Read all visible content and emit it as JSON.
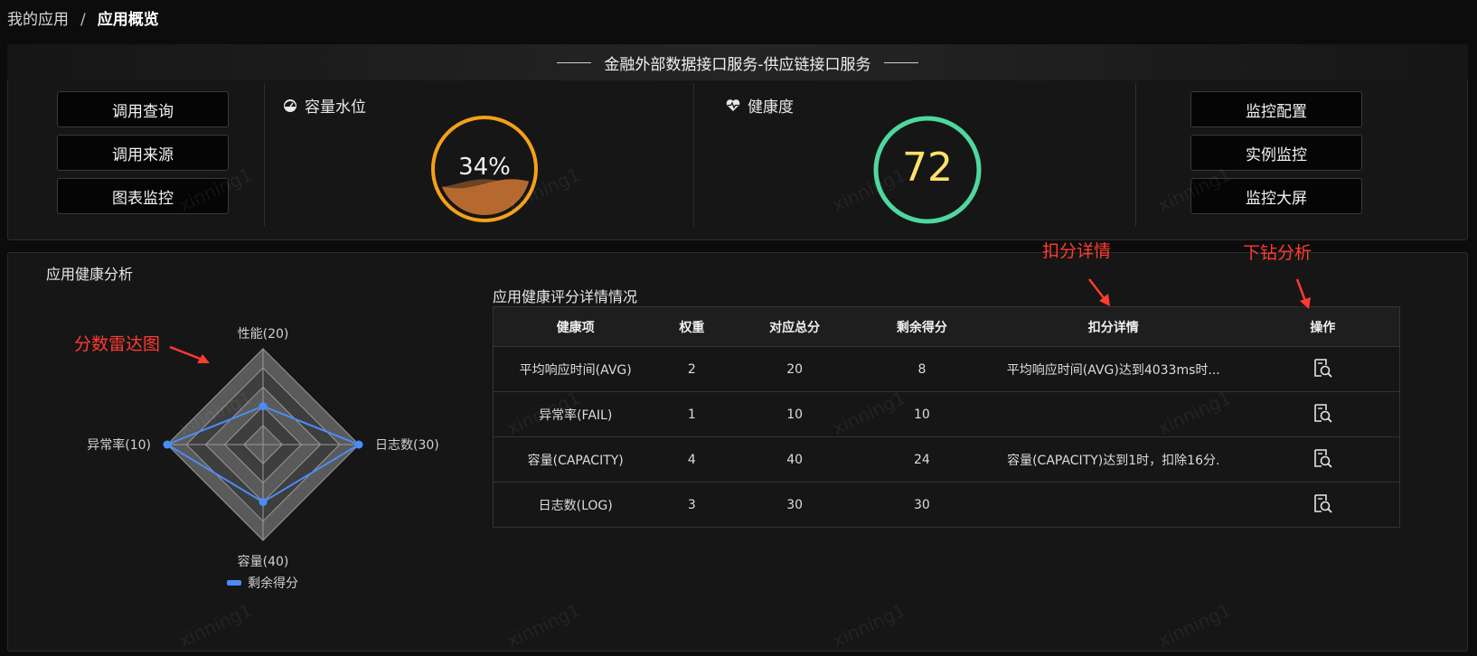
{
  "breadcrumb": {
    "parent": "我的应用",
    "separator": "/",
    "current": "应用概览"
  },
  "service": {
    "title": "金融外部数据接口服务-供应链接口服务"
  },
  "left_buttons": [
    "调用查询",
    "调用来源",
    "图表监控"
  ],
  "right_buttons": [
    "监控配置",
    "实例监控",
    "监控大屏"
  ],
  "capacity": {
    "label": "容量水位",
    "value_text": "34%",
    "value": 0.34,
    "ring_color": "#f5a01a",
    "fill_color": "#b5692f"
  },
  "health": {
    "label": "健康度",
    "score": "72",
    "ring_color": "#4ed8a0",
    "score_color": "#ffe16b"
  },
  "analysis": {
    "title": "应用健康分析"
  },
  "radar": {
    "axes": [
      "性能(20)",
      "日志数(30)",
      "容量(40)",
      "异常率(10)"
    ],
    "legend": "剩余得分",
    "series_color": "#4a8cf7"
  },
  "chart_data": {
    "type": "radar",
    "categories": [
      "性能(20)",
      "日志数(30)",
      "容量(40)",
      "异常率(10)"
    ],
    "max": [
      20,
      30,
      40,
      10
    ],
    "series": [
      {
        "name": "剩余得分",
        "values": [
          8,
          30,
          24,
          10
        ]
      }
    ]
  },
  "table": {
    "title": "应用健康评分详情情况",
    "headers": [
      "健康项",
      "权重",
      "对应总分",
      "剩余得分",
      "扣分详情",
      "操作"
    ],
    "rows": [
      {
        "item": "平均响应时间(AVG)",
        "weight": "2",
        "total": "20",
        "remain": "8",
        "detail": "平均响应时间(AVG)达到4033ms时..."
      },
      {
        "item": "异常率(FAIL)",
        "weight": "1",
        "total": "10",
        "remain": "10",
        "detail": ""
      },
      {
        "item": "容量(CAPACITY)",
        "weight": "4",
        "total": "40",
        "remain": "24",
        "detail": "容量(CAPACITY)达到1时，扣除16分."
      },
      {
        "item": "日志数(LOG)",
        "weight": "3",
        "total": "30",
        "remain": "30",
        "detail": ""
      }
    ]
  },
  "annotations": {
    "radar": "分数雷达图",
    "deduction": "扣分详情",
    "drill": "下钻分析"
  },
  "watermark": "xinning1"
}
